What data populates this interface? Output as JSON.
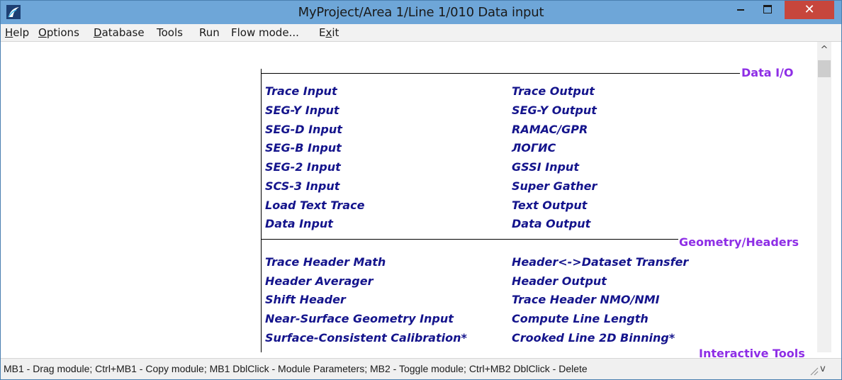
{
  "window": {
    "title": "MyProject/Area 1/Line 1/010 Data input",
    "icon": "app-logo-icon",
    "close_glyph": "✕"
  },
  "menu": [
    {
      "label": "Help"
    },
    {
      "label": "Options"
    },
    {
      "label": "Database"
    },
    {
      "label": "Tools"
    },
    {
      "label": "Run"
    },
    {
      "label": "Flow mode..."
    },
    {
      "label": "Exit"
    }
  ],
  "sections": [
    {
      "title": "Data I/O",
      "left": [
        "Trace Input",
        "SEG-Y Input",
        "SEG-D Input",
        "SEG-B Input",
        "SEG-2 Input",
        "SCS-3 Input",
        "Load Text Trace",
        "Data Input"
      ],
      "right": [
        "Trace Output",
        "SEG-Y Output",
        "RAMAC/GPR",
        "ЛОГИС",
        "GSSI Input",
        "Super Gather",
        "Text Output",
        "Data Output"
      ]
    },
    {
      "title": "Geometry/Headers",
      "left": [
        "Trace Header Math",
        "Header Averager",
        "Shift Header",
        "Near-Surface Geometry Input",
        "Surface-Consistent Calibration*"
      ],
      "right": [
        "Header<->Dataset Transfer",
        "Header Output",
        "Trace Header NMO/NMI",
        "Compute Line Length",
        "Crooked Line 2D Binning*"
      ]
    },
    {
      "title": "Interactive Tools"
    }
  ],
  "status": {
    "text": "MB1 - Drag module; Ctrl+MB1 - Copy module; MB1  DblClick - Module Parameters; MB2 - Toggle module; Ctrl+MB2 DblClick - Delete"
  },
  "colors": {
    "titlebar": "#6ea6d8",
    "close": "#c7463c",
    "section_title": "#8e2ee6",
    "module_text": "#14148c"
  }
}
